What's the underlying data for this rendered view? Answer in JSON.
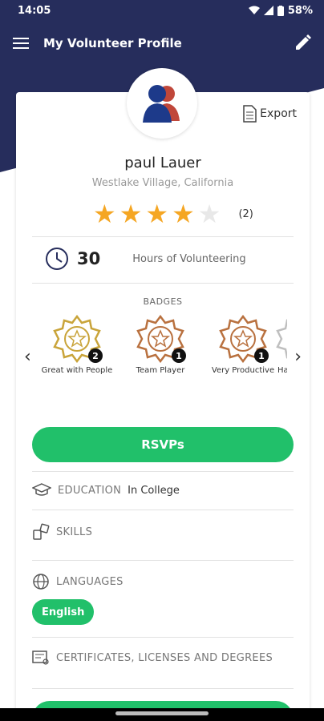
{
  "status": {
    "time": "14:05",
    "battery": "58%"
  },
  "appbar": {
    "title": "My Volunteer Profile"
  },
  "profile": {
    "export_label": "Export",
    "name": "paul Lauer",
    "location": "Westlake Village, California",
    "rating": 4,
    "rating_max": 5,
    "rating_count": "(2)",
    "hours": "30",
    "hours_label": "Hours of Volunteering"
  },
  "badges": {
    "title": "BADGES",
    "items": [
      {
        "label": "Great with People",
        "count": "2",
        "color": "#c9a43a"
      },
      {
        "label": "Team Player",
        "count": "1",
        "color": "#b9713f"
      },
      {
        "label": "Very Productive",
        "count": "1",
        "color": "#b9713f"
      },
      {
        "label": "Ha",
        "count": "",
        "color": "#bfbfbf"
      }
    ]
  },
  "rsvp_label": "RSVPs",
  "education": {
    "label": "EDUCATION",
    "value": "In College"
  },
  "skills": {
    "label": "SKILLS"
  },
  "languages": {
    "label": "LANGUAGES",
    "items": [
      "English"
    ]
  },
  "certificates": {
    "label": "CERTIFICATES, LICENSES AND DEGREES"
  },
  "colors": {
    "header": "#262d5c",
    "accent": "#21c06a",
    "star": "#f5a623",
    "star_empty": "#e8e8e8"
  }
}
